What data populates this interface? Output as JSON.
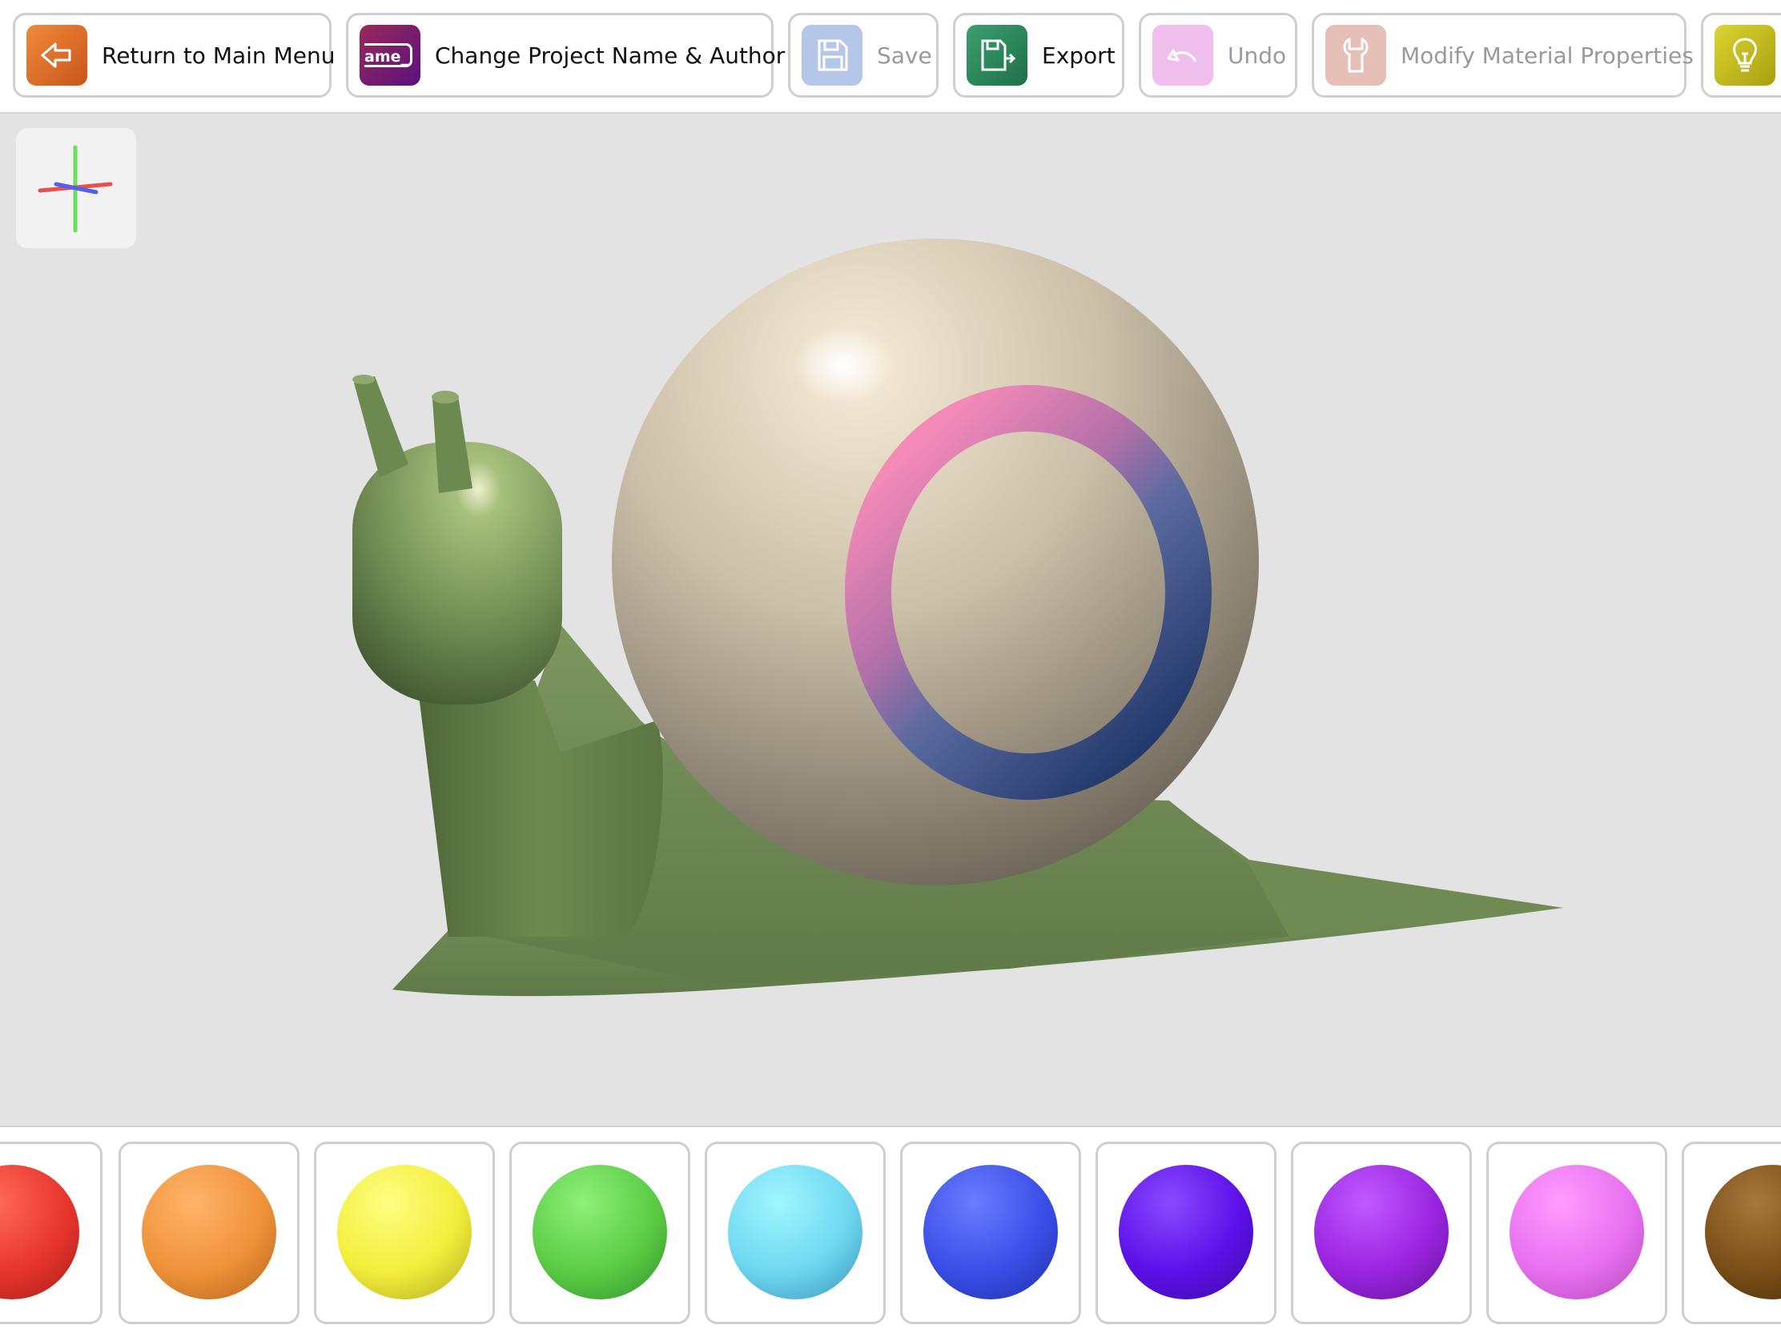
{
  "toolbar": {
    "buttons": [
      {
        "label": "Return to Main Menu",
        "icon": "back-arrow-icon",
        "color": "#d9702a",
        "enabled": true
      },
      {
        "label": "Change Project Name & Author",
        "icon": "name-tag-icon",
        "chip_text": "ame_",
        "color": "#7a1a6a",
        "enabled": true
      },
      {
        "label": "Save",
        "icon": "save-icon",
        "color": "#6f8fc8",
        "enabled": false
      },
      {
        "label": "Export",
        "icon": "export-icon",
        "color": "#2f8a5e",
        "enabled": true
      },
      {
        "label": "Undo",
        "icon": "undo-icon",
        "color": "#e070d8",
        "enabled": false
      },
      {
        "label": "Modify Material Properties",
        "icon": "wrench-icon",
        "color": "#c97560",
        "enabled": false
      },
      {
        "label": "",
        "icon": "lightbulb-icon",
        "color": "#c9c020",
        "enabled": true
      }
    ]
  },
  "viewport": {
    "axis_colors": {
      "x": "#e85050",
      "y": "#6ee060",
      "z": "#5060e8"
    },
    "model_colors": {
      "body": "#6f8a55",
      "shell": "#cfc3ad",
      "ring_top": "#f080b0",
      "ring_bottom": "#2a3f70"
    }
  },
  "palette": {
    "colors": [
      {
        "name": "red",
        "color": "#e8352e"
      },
      {
        "name": "orange",
        "color": "#f0923a"
      },
      {
        "name": "yellow",
        "color": "#f2ee3c"
      },
      {
        "name": "green",
        "color": "#5ccc45"
      },
      {
        "name": "cyan",
        "color": "#6ed8f0"
      },
      {
        "name": "blue",
        "color": "#3a4ee8"
      },
      {
        "name": "indigo",
        "color": "#5c10e8"
      },
      {
        "name": "purple",
        "color": "#9a24e0"
      },
      {
        "name": "pink",
        "color": "#e870f0"
      },
      {
        "name": "brown",
        "color": "#7a4e18"
      }
    ]
  }
}
